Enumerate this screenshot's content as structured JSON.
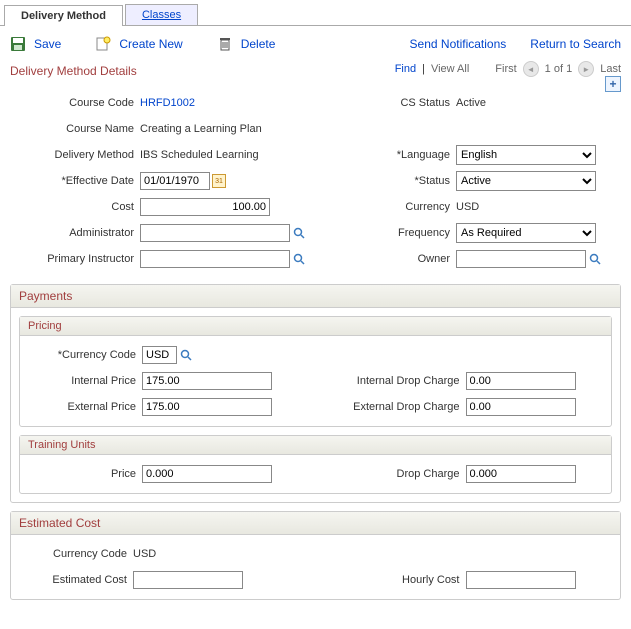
{
  "tabs": {
    "delivery": "Delivery Method",
    "classes": "Classes"
  },
  "toolbar": {
    "save": "Save",
    "create": "Create New",
    "delete": "Delete",
    "notify": "Send Notifications",
    "return": "Return to Search"
  },
  "section_title": "Delivery Method Details",
  "nav": {
    "find": "Find",
    "view_all": "View All",
    "first": "First",
    "position": "1 of 1",
    "last": "Last"
  },
  "labels": {
    "course_code": "Course Code",
    "cs_status": "CS Status",
    "course_name": "Course Name",
    "delivery_method": "Delivery Method",
    "language": "*Language",
    "effective_date": "*Effective Date",
    "status": "*Status",
    "cost": "Cost",
    "currency": "Currency",
    "administrator": "Administrator",
    "frequency": "Frequency",
    "primary_instructor": "Primary Instructor",
    "owner": "Owner"
  },
  "values": {
    "course_code": "HRFD1002",
    "cs_status": "Active",
    "course_name": "Creating a Learning Plan",
    "delivery_method": "IBS Scheduled Learning",
    "language": "English",
    "effective_date": "01/01/1970",
    "status": "Active",
    "cost": "100.00",
    "currency": "USD",
    "administrator": "",
    "frequency": "As Required",
    "primary_instructor": "",
    "owner": ""
  },
  "payments": {
    "title": "Payments",
    "pricing": {
      "title": "Pricing",
      "currency_code_label": "*Currency Code",
      "currency_code": "USD",
      "internal_price_label": "Internal Price",
      "internal_price": "175.00",
      "internal_drop_label": "Internal Drop Charge",
      "internal_drop": "0.00",
      "external_price_label": "External Price",
      "external_price": "175.00",
      "external_drop_label": "External Drop Charge",
      "external_drop": "0.00"
    },
    "training_units": {
      "title": "Training Units",
      "price_label": "Price",
      "price": "0.000",
      "drop_label": "Drop Charge",
      "drop": "0.000"
    }
  },
  "estimated_cost": {
    "title": "Estimated Cost",
    "currency_code_label": "Currency Code",
    "currency_code": "USD",
    "est_cost_label": "Estimated Cost",
    "est_cost": "",
    "hourly_label": "Hourly Cost",
    "hourly": ""
  }
}
